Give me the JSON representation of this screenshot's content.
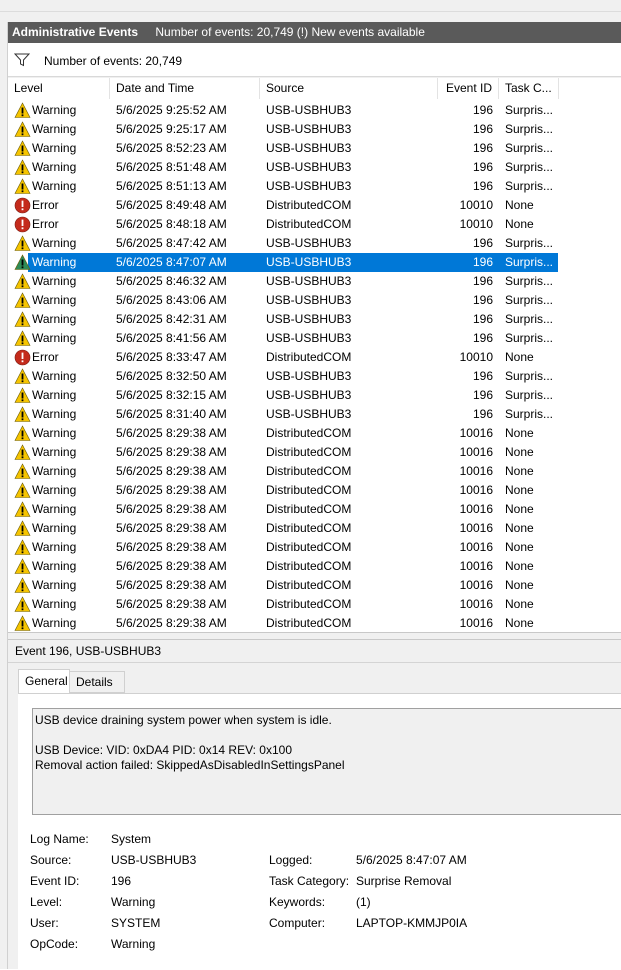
{
  "titlebar": {
    "title": "Administrative Events",
    "summary": "Number of events: 20,749 (!) New events available"
  },
  "filterbar": {
    "icon": "filter-icon",
    "count_text": "Number of events: 20,749"
  },
  "columns": {
    "level": "Level",
    "date": "Date and Time",
    "source": "Source",
    "event_id": "Event ID",
    "task": "Task C..."
  },
  "colors": {
    "title_bg": "#5a5a5a",
    "selection": "#0078d7",
    "warning": "#f5c400",
    "error": "#c42b1c",
    "selected_warning": "#2e8b57"
  },
  "events": [
    {
      "level": "Warning",
      "date": "5/6/2025 9:25:52 AM",
      "source": "USB-USBHUB3",
      "id": "196",
      "task": "Surpris..."
    },
    {
      "level": "Warning",
      "date": "5/6/2025 9:25:17 AM",
      "source": "USB-USBHUB3",
      "id": "196",
      "task": "Surpris..."
    },
    {
      "level": "Warning",
      "date": "5/6/2025 8:52:23 AM",
      "source": "USB-USBHUB3",
      "id": "196",
      "task": "Surpris..."
    },
    {
      "level": "Warning",
      "date": "5/6/2025 8:51:48 AM",
      "source": "USB-USBHUB3",
      "id": "196",
      "task": "Surpris..."
    },
    {
      "level": "Warning",
      "date": "5/6/2025 8:51:13 AM",
      "source": "USB-USBHUB3",
      "id": "196",
      "task": "Surpris..."
    },
    {
      "level": "Error",
      "date": "5/6/2025 8:49:48 AM",
      "source": "DistributedCOM",
      "id": "10010",
      "task": "None"
    },
    {
      "level": "Error",
      "date": "5/6/2025 8:48:18 AM",
      "source": "DistributedCOM",
      "id": "10010",
      "task": "None"
    },
    {
      "level": "Warning",
      "date": "5/6/2025 8:47:42 AM",
      "source": "USB-USBHUB3",
      "id": "196",
      "task": "Surpris..."
    },
    {
      "level": "Warning",
      "date": "5/6/2025 8:47:07 AM",
      "source": "USB-USBHUB3",
      "id": "196",
      "task": "Surpris...",
      "selected": true
    },
    {
      "level": "Warning",
      "date": "5/6/2025 8:46:32 AM",
      "source": "USB-USBHUB3",
      "id": "196",
      "task": "Surpris..."
    },
    {
      "level": "Warning",
      "date": "5/6/2025 8:43:06 AM",
      "source": "USB-USBHUB3",
      "id": "196",
      "task": "Surpris..."
    },
    {
      "level": "Warning",
      "date": "5/6/2025 8:42:31 AM",
      "source": "USB-USBHUB3",
      "id": "196",
      "task": "Surpris..."
    },
    {
      "level": "Warning",
      "date": "5/6/2025 8:41:56 AM",
      "source": "USB-USBHUB3",
      "id": "196",
      "task": "Surpris..."
    },
    {
      "level": "Error",
      "date": "5/6/2025 8:33:47 AM",
      "source": "DistributedCOM",
      "id": "10010",
      "task": "None"
    },
    {
      "level": "Warning",
      "date": "5/6/2025 8:32:50 AM",
      "source": "USB-USBHUB3",
      "id": "196",
      "task": "Surpris..."
    },
    {
      "level": "Warning",
      "date": "5/6/2025 8:32:15 AM",
      "source": "USB-USBHUB3",
      "id": "196",
      "task": "Surpris..."
    },
    {
      "level": "Warning",
      "date": "5/6/2025 8:31:40 AM",
      "source": "USB-USBHUB3",
      "id": "196",
      "task": "Surpris..."
    },
    {
      "level": "Warning",
      "date": "5/6/2025 8:29:38 AM",
      "source": "DistributedCOM",
      "id": "10016",
      "task": "None"
    },
    {
      "level": "Warning",
      "date": "5/6/2025 8:29:38 AM",
      "source": "DistributedCOM",
      "id": "10016",
      "task": "None"
    },
    {
      "level": "Warning",
      "date": "5/6/2025 8:29:38 AM",
      "source": "DistributedCOM",
      "id": "10016",
      "task": "None"
    },
    {
      "level": "Warning",
      "date": "5/6/2025 8:29:38 AM",
      "source": "DistributedCOM",
      "id": "10016",
      "task": "None"
    },
    {
      "level": "Warning",
      "date": "5/6/2025 8:29:38 AM",
      "source": "DistributedCOM",
      "id": "10016",
      "task": "None"
    },
    {
      "level": "Warning",
      "date": "5/6/2025 8:29:38 AM",
      "source": "DistributedCOM",
      "id": "10016",
      "task": "None"
    },
    {
      "level": "Warning",
      "date": "5/6/2025 8:29:38 AM",
      "source": "DistributedCOM",
      "id": "10016",
      "task": "None"
    },
    {
      "level": "Warning",
      "date": "5/6/2025 8:29:38 AM",
      "source": "DistributedCOM",
      "id": "10016",
      "task": "None"
    },
    {
      "level": "Warning",
      "date": "5/6/2025 8:29:38 AM",
      "source": "DistributedCOM",
      "id": "10016",
      "task": "None"
    },
    {
      "level": "Warning",
      "date": "5/6/2025 8:29:38 AM",
      "source": "DistributedCOM",
      "id": "10016",
      "task": "None"
    },
    {
      "level": "Warning",
      "date": "5/6/2025 8:29:38 AM",
      "source": "DistributedCOM",
      "id": "10016",
      "task": "None"
    }
  ],
  "detail": {
    "title": "Event 196, USB-USBHUB3",
    "tabs": {
      "general": "General",
      "details": "Details"
    },
    "message": "USB device draining system power when system is idle.\n\nUSB Device: VID: 0xDA4 PID: 0x14 REV: 0x100\nRemoval action failed: SkippedAsDisabledInSettingsPanel",
    "labels": {
      "log_name": "Log Name:",
      "source": "Source:",
      "event_id": "Event ID:",
      "level": "Level:",
      "user": "User:",
      "opcode": "OpCode:",
      "logged": "Logged:",
      "task_category": "Task Category:",
      "keywords": "Keywords:",
      "computer": "Computer:"
    },
    "values": {
      "log_name": "System",
      "source": "USB-USBHUB3",
      "event_id": "196",
      "level": "Warning",
      "user": "SYSTEM",
      "opcode": "Warning",
      "logged": "5/6/2025 8:47:07 AM",
      "task_category": "Surprise Removal",
      "keywords": "(1)",
      "computer": "LAPTOP-KMMJP0IA"
    }
  }
}
